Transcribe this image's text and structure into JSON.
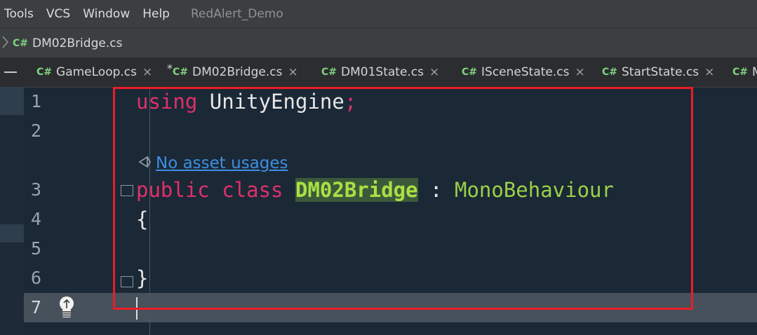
{
  "menubar": {
    "items": [
      "Tools",
      "VCS",
      "Window",
      "Help"
    ],
    "project_title": "RedAlert_Demo"
  },
  "breadcrumb": {
    "badge": "C#",
    "file": "DM02Bridge.cs"
  },
  "tabs": [
    {
      "badge": "C#",
      "label": "GameLoop.cs",
      "close": "×"
    },
    {
      "badge": "C#",
      "label": "DM02Bridge.cs",
      "close": "×",
      "modified": "*",
      "active": true
    },
    {
      "badge": "C#",
      "label": "DM01State.cs",
      "close": "×"
    },
    {
      "badge": "C#",
      "label": "ISceneState.cs",
      "close": "×"
    },
    {
      "badge": "C#",
      "label": "StartState.cs",
      "close": "×"
    },
    {
      "badge": "C#",
      "label": "M"
    }
  ],
  "editor": {
    "line_numbers": [
      "1",
      "2",
      "3",
      "4",
      "5",
      "6",
      "7"
    ],
    "code": {
      "l1_kw": "using",
      "l1_ns": " UnityEngine",
      "l1_semi": ";",
      "l3_kw": "public class ",
      "l3_class": "DM02Bridge",
      "l3_sep": " : ",
      "l3_base": "MonoBehaviour",
      "l4": "{",
      "l6": "}"
    },
    "hint": "No asset usages",
    "current_line": 7
  },
  "colors": {
    "keyword": "#e0306a",
    "type": "#9ad147",
    "link": "#3d8fe0",
    "annotation": "#ea1d26"
  }
}
